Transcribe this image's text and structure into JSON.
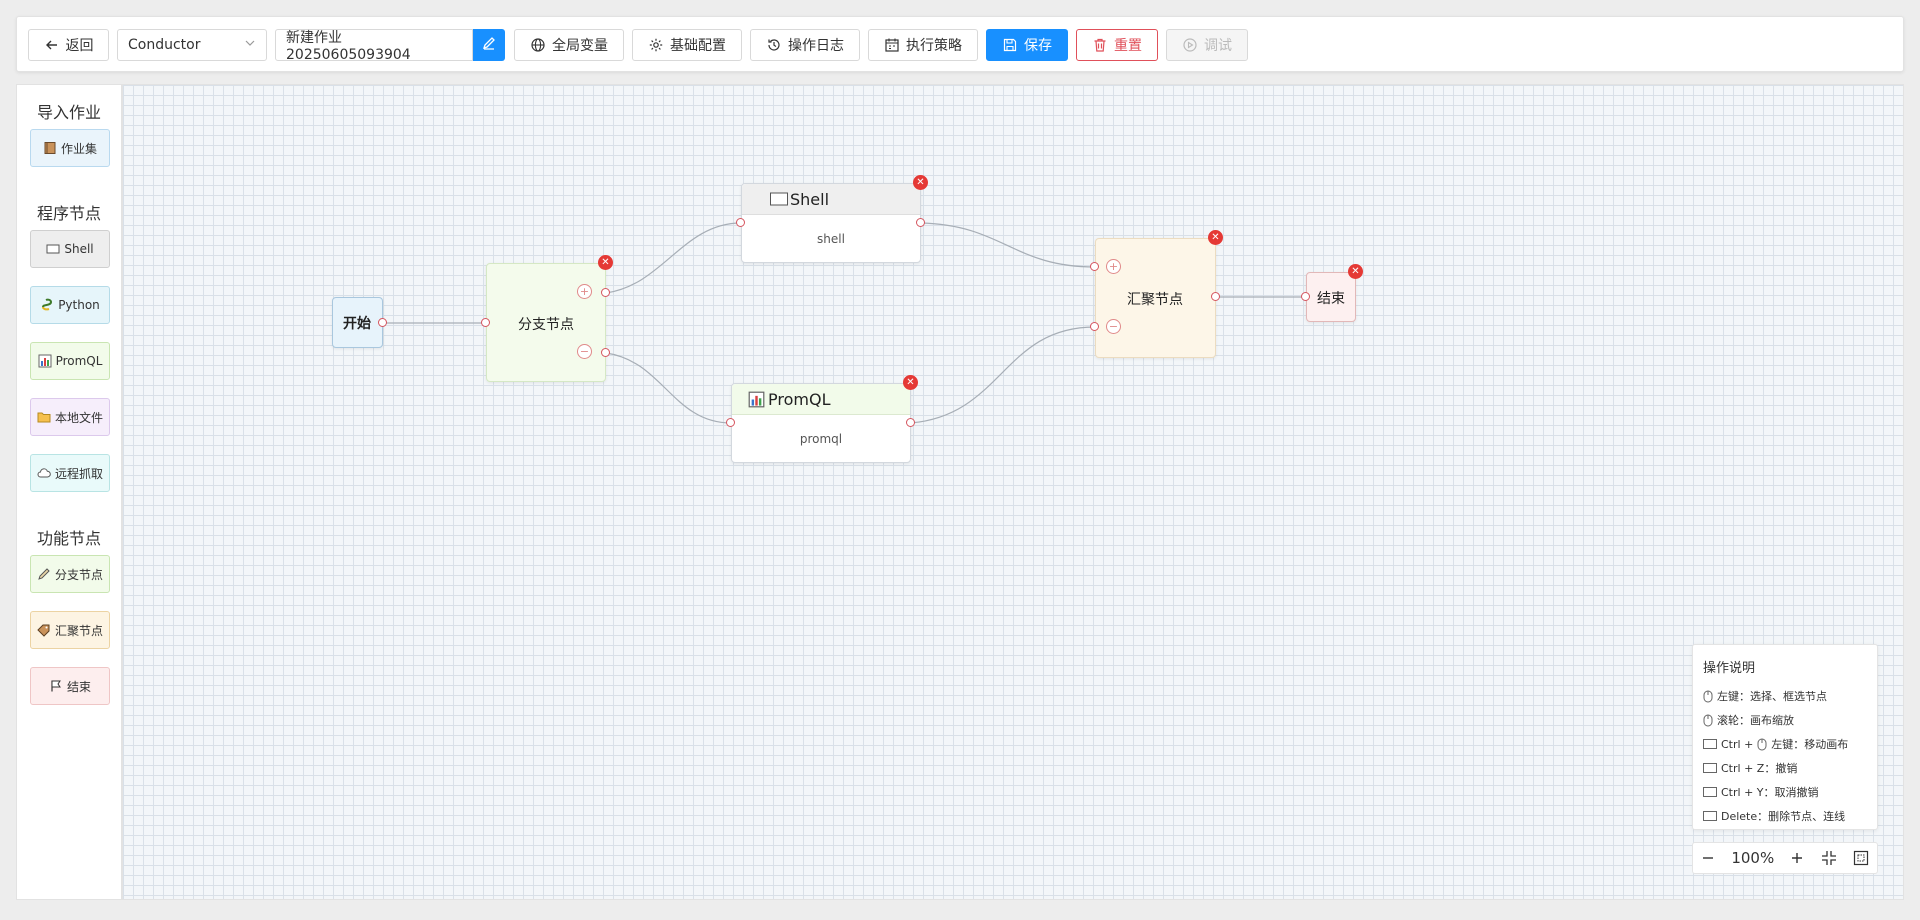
{
  "toolbar": {
    "back_label": "返回",
    "engine_select": "Conductor",
    "job_name": "新建作业20250605093904",
    "global_vars_label": "全局变量",
    "base_config_label": "基础配置",
    "op_log_label": "操作日志",
    "exec_strategy_label": "执行策略",
    "save_label": "保存",
    "reset_label": "重置",
    "debug_label": "调试"
  },
  "sidebar": {
    "import_heading": "导入作业",
    "import_items": [
      {
        "label": "作业集",
        "icon": "book-icon"
      }
    ],
    "program_heading": "程序节点",
    "program_items": [
      {
        "label": "Shell",
        "icon": "terminal-icon"
      },
      {
        "label": "Python",
        "icon": "python-icon"
      },
      {
        "label": "PromQL",
        "icon": "chart-icon"
      },
      {
        "label": "本地文件",
        "icon": "folder-icon"
      },
      {
        "label": "远程抓取",
        "icon": "cloud-icon"
      }
    ],
    "function_heading": "功能节点",
    "function_items": [
      {
        "label": "分支节点",
        "icon": "pencil-icon"
      },
      {
        "label": "汇聚节点",
        "icon": "tag-icon"
      },
      {
        "label": "结束",
        "icon": "flag-icon"
      }
    ]
  },
  "canvas": {
    "nodes": {
      "start": {
        "label": "开始"
      },
      "branch": {
        "label": "分支节点"
      },
      "shell": {
        "title": "Shell",
        "body": "shell"
      },
      "promql": {
        "title": "PromQL",
        "body": "promql"
      },
      "merge": {
        "label": "汇聚节点"
      },
      "end": {
        "label": "结束"
      }
    },
    "close_glyph": "✕",
    "plus_glyph": "+",
    "minus_glyph": "−"
  },
  "help": {
    "title": "操作说明",
    "rows": [
      {
        "text": "左键：选择、框选节点",
        "icon": "mouse-icon"
      },
      {
        "text": "滚轮：画布缩放",
        "icon": "mouse-icon"
      },
      {
        "text_pre": "Ctrl + ",
        "text_post": "左键：移动画布",
        "icon": "keyboard-icon"
      },
      {
        "text": "Ctrl + Z：撤销",
        "icon": "keyboard-icon"
      },
      {
        "text": "Ctrl + Y：取消撤销",
        "icon": "keyboard-icon"
      },
      {
        "text": "Delete：删除节点、连线",
        "icon": "keyboard-icon"
      }
    ]
  },
  "zoom": {
    "value": "100%"
  },
  "colors": {
    "primary": "#1890ff",
    "danger": "#e0505a",
    "branch_bg": "#f4fbec",
    "merge_bg": "#fdf6e8",
    "end_bg": "#fdf0f0",
    "start_bg": "#e7f3fb"
  }
}
